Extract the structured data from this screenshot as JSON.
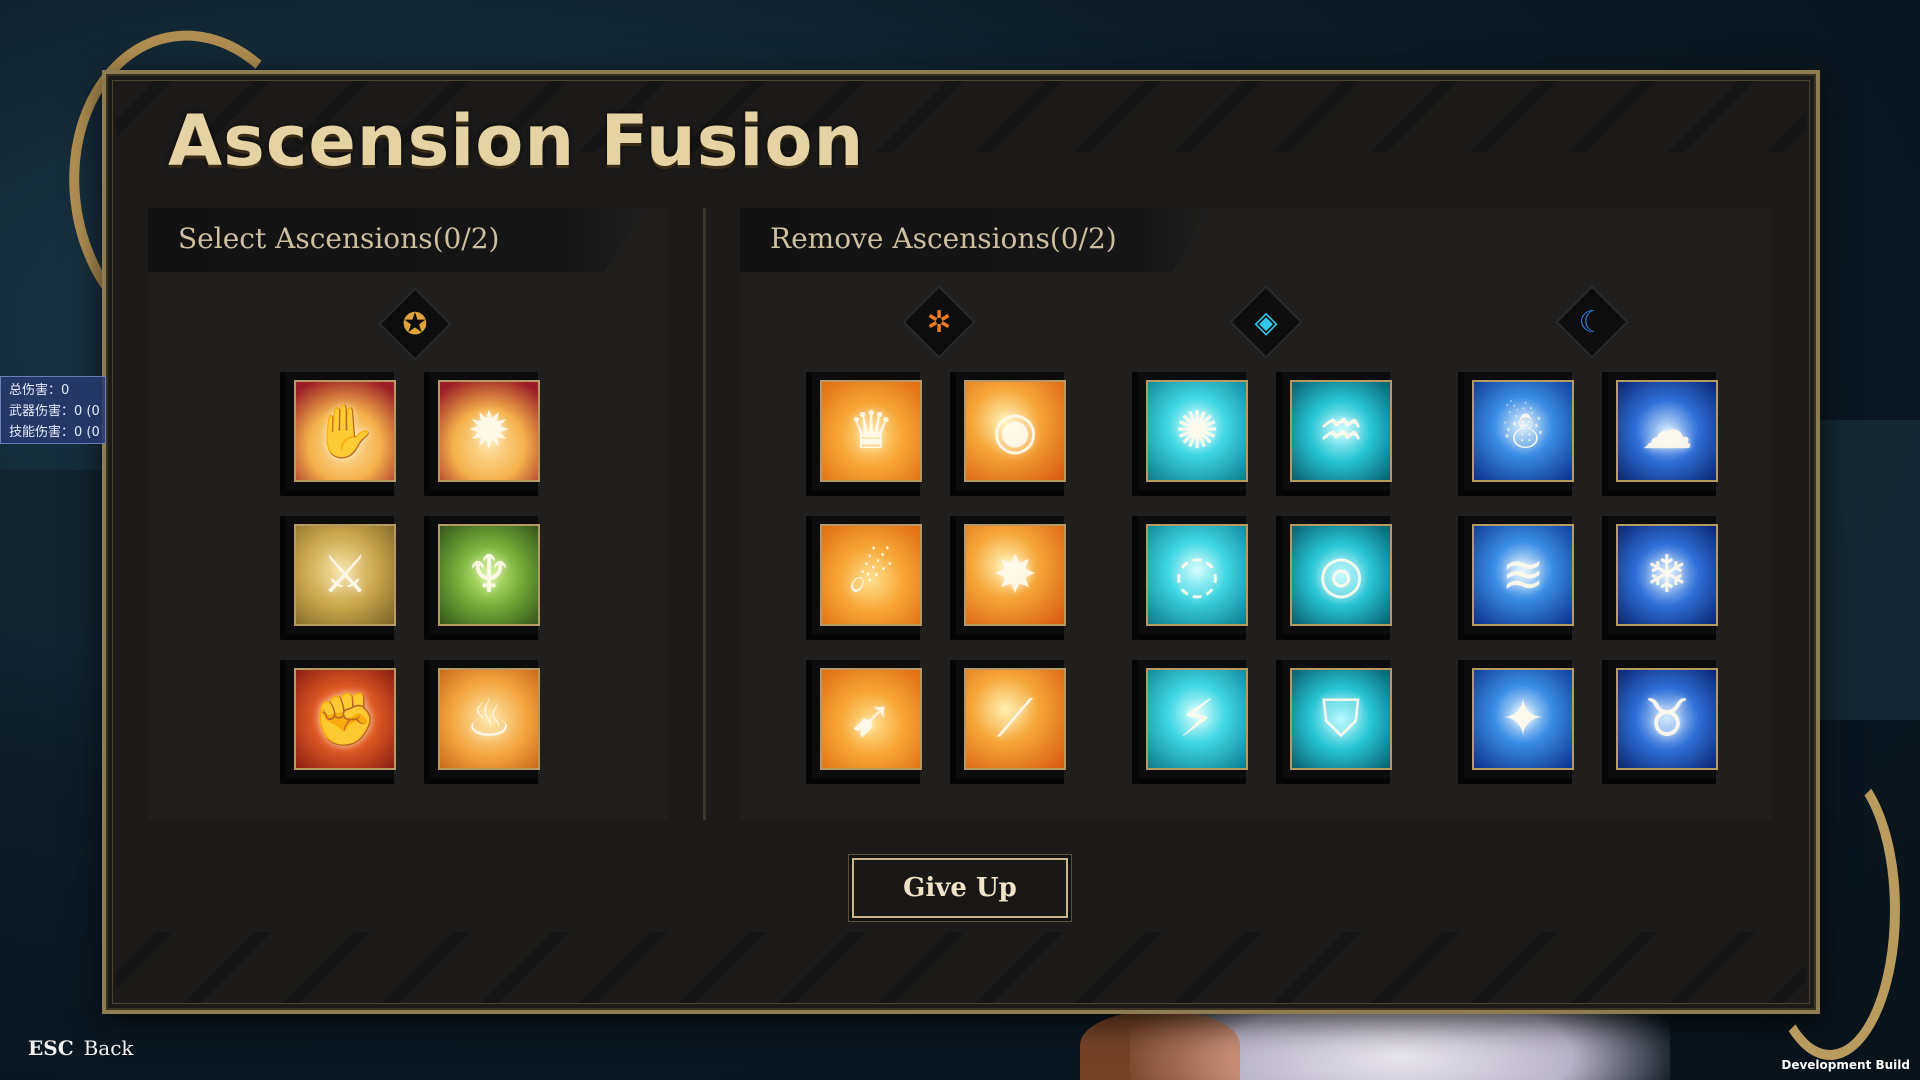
{
  "window": {
    "title": "Ascension Fusion"
  },
  "select_panel": {
    "title": "Select Ascensions(0/2)",
    "element_icon": "neutral-element-icon",
    "icons": [
      {
        "name": "split-fist-crimson-icon",
        "style": "crim",
        "glyph": "✋"
      },
      {
        "name": "flame-burst-crimson-icon",
        "style": "crim",
        "glyph": "✹"
      },
      {
        "name": "blade-strike-icon",
        "style": "tan",
        "glyph": "⚔"
      },
      {
        "name": "rising-figure-icon",
        "style": "green",
        "glyph": "♆"
      },
      {
        "name": "spinning-fist-icon",
        "style": "red",
        "glyph": "✊"
      },
      {
        "name": "flame-scroll-icon",
        "style": "orange",
        "glyph": "♨"
      }
    ]
  },
  "remove_panel": {
    "title": "Remove Ascensions(0/2)",
    "groups": [
      {
        "element_icon": "fire-element-icon",
        "element_glyph": "✲",
        "element_color": "#f07a1e",
        "icons": [
          {
            "name": "flame-crown-icon",
            "style": "fire-a",
            "glyph": "♛"
          },
          {
            "name": "flame-eye-icon",
            "style": "fire-b",
            "glyph": "◉"
          },
          {
            "name": "crouching-figure-icon",
            "style": "fire-a",
            "glyph": "☄"
          },
          {
            "name": "body-burst-icon",
            "style": "fire-b",
            "glyph": "✸"
          },
          {
            "name": "fire-dash-icon",
            "style": "fire-a",
            "glyph": "➹"
          },
          {
            "name": "flame-slash-icon",
            "style": "fire-b",
            "glyph": "⟋"
          }
        ]
      },
      {
        "element_icon": "water-element-icon",
        "element_glyph": "◈",
        "element_color": "#34c6ec",
        "icons": [
          {
            "name": "orb-burst-icon",
            "style": "aqua",
            "glyph": "✺"
          },
          {
            "name": "water-surge-icon",
            "style": "aqua-d",
            "glyph": "♒"
          },
          {
            "name": "whirlpool-orb-icon",
            "style": "aqua",
            "glyph": "◌"
          },
          {
            "name": "vortex-icon",
            "style": "aqua-d",
            "glyph": "◎"
          },
          {
            "name": "lightning-dash-icon",
            "style": "aqua",
            "glyph": "⚡"
          },
          {
            "name": "water-shield-icon",
            "style": "aqua-d",
            "glyph": "⛉"
          }
        ]
      },
      {
        "element_icon": "wind-element-icon",
        "element_glyph": "☾",
        "element_color": "#2e7de0",
        "icons": [
          {
            "name": "summoned-spirit-icon",
            "style": "ice",
            "glyph": "☃"
          },
          {
            "name": "cloud-spirit-icon",
            "style": "ice-d",
            "glyph": "☁"
          },
          {
            "name": "shock-wave-icon",
            "style": "ice",
            "glyph": "≋"
          },
          {
            "name": "crystal-fist-icon",
            "style": "ice-d",
            "glyph": "❄"
          },
          {
            "name": "storm-impact-icon",
            "style": "ice",
            "glyph": "✦"
          },
          {
            "name": "twin-horns-icon",
            "style": "ice-d",
            "glyph": "♉"
          }
        ]
      }
    ]
  },
  "give_up_button": "Give Up",
  "debug_stats": [
    "总伤害：0",
    "武器伤害：0 (0",
    "技能伤害：0 (0"
  ],
  "esc_hint": {
    "key": "ESC",
    "label": "Back"
  },
  "dev_build": "Development Build"
}
